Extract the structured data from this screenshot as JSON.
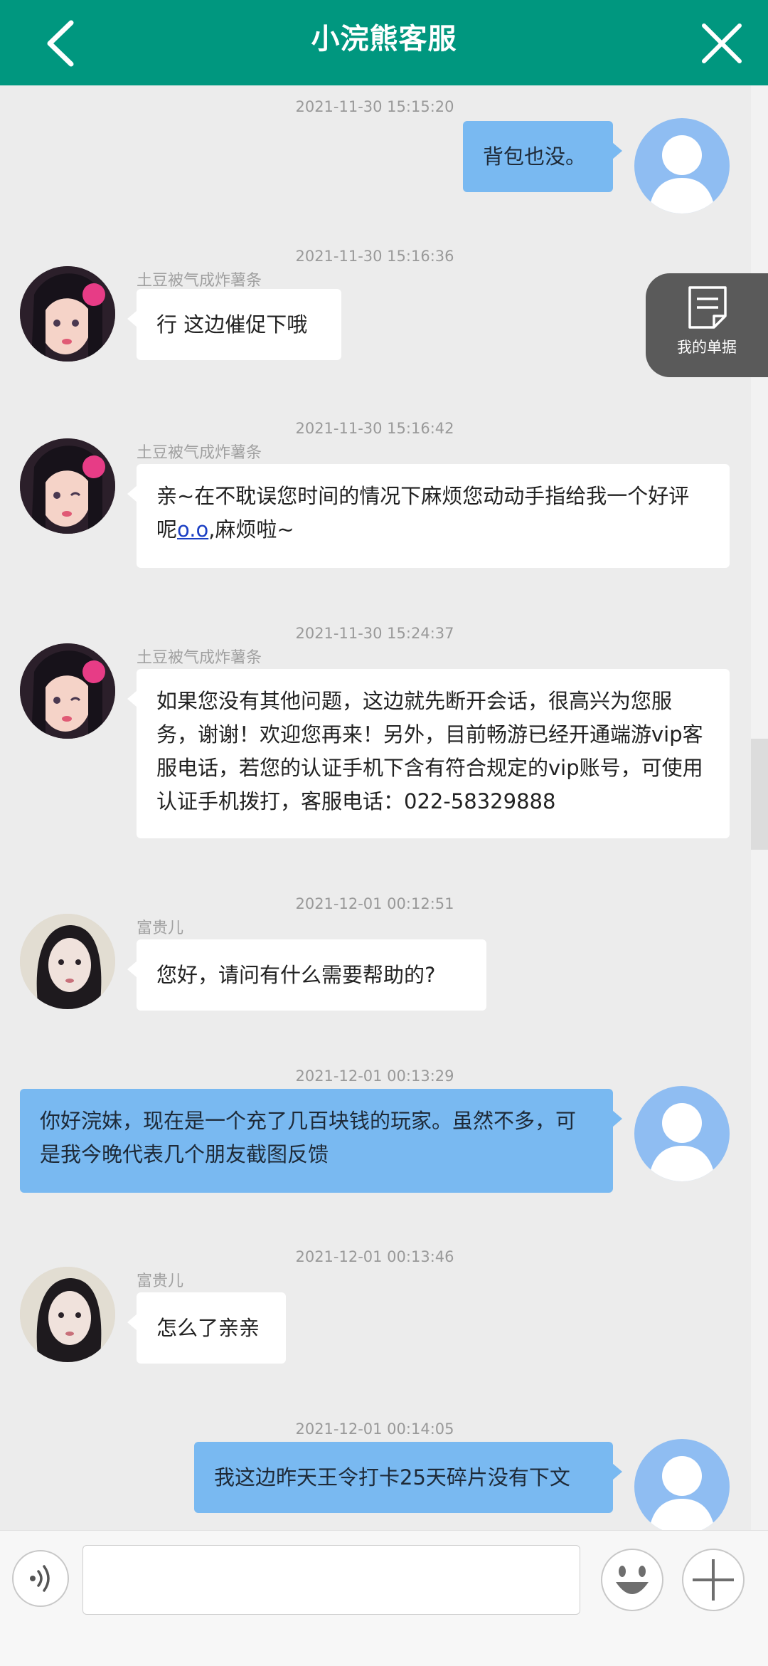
{
  "header": {
    "title": "小浣熊客服"
  },
  "receipt": {
    "label": "我的单据"
  },
  "input": {
    "value": ""
  },
  "messages": [
    {
      "time": "2021-11-30 15:15:20",
      "role": "user",
      "text": "背包也没。"
    },
    {
      "time": "2021-11-30 15:16:36",
      "role": "agent",
      "sender": "土豆被气成炸薯条",
      "text": "行  这边催促下哦"
    },
    {
      "time": "2021-11-30 15:16:42",
      "role": "agent",
      "sender": "土豆被气成炸薯条",
      "text_before": "亲~在不耽误您时间的情况下麻烦您动动手指给我一个好评呢",
      "link": "o.o",
      "text_after": ",麻烦啦~"
    },
    {
      "time": "2021-11-30 15:24:37",
      "role": "agent",
      "sender": "土豆被气成炸薯条",
      "text": "如果您没有其他问题，这边就先断开会话，很高兴为您服务，谢谢！欢迎您再来！另外，目前畅游已经开通端游vip客服电话，若您的认证手机下含有符合规定的vip账号，可使用认证手机拨打，客服电话：022-58329888"
    },
    {
      "time": "2021-12-01 00:12:51",
      "role": "agent",
      "sender": "富贵儿",
      "text": "您好，请问有什么需要帮助的?"
    },
    {
      "time": "2021-12-01 00:13:29",
      "role": "user",
      "text": "你好浣妹，现在是一个充了几百块钱的玩家。虽然不多，可是我今晚代表几个朋友截图反馈"
    },
    {
      "time": "2021-12-01 00:13:46",
      "role": "agent",
      "sender": "富贵儿",
      "text": "怎么了亲亲"
    },
    {
      "time": "2021-12-01 00:14:05",
      "role": "user",
      "text": "我这边昨天王令打卡25天碎片没有下文"
    }
  ]
}
